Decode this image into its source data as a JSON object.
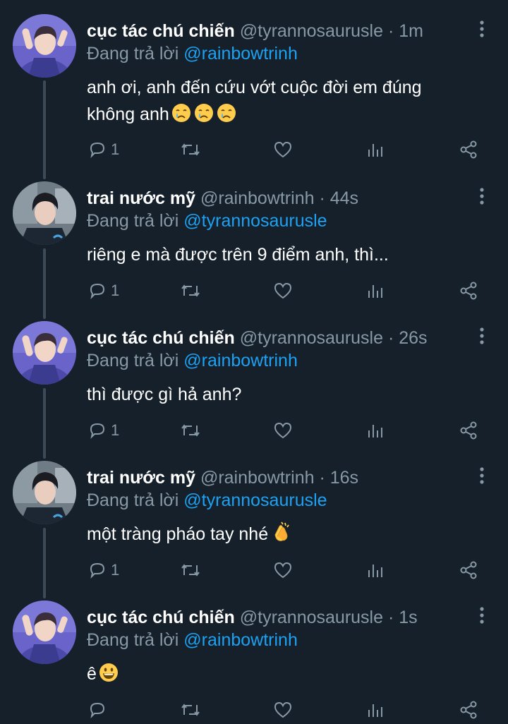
{
  "tweets": [
    {
      "name": "cục tác chú chiến",
      "handle": "@tyrannosaurusle",
      "time": "1m",
      "reply_prefix": "Đang trả lời",
      "reply_to": "@rainbowtrinh",
      "text": "anh ơi, anh đến cứu vớt cuộc đời em đúng không anh",
      "emoji": [
        "crying-face",
        "crying-face",
        "crying-face"
      ],
      "reply_count": "1"
    },
    {
      "name": "trai nước mỹ",
      "handle": "@rainbowtrinh",
      "time": "44s",
      "reply_prefix": "Đang trả lời",
      "reply_to": "@tyrannosaurusle",
      "text": "riêng e mà được trên 9 điểm anh, thì...",
      "emoji": [],
      "reply_count": "1"
    },
    {
      "name": "cục tác chú chiến",
      "handle": "@tyrannosaurusle",
      "time": "26s",
      "reply_prefix": "Đang trả lời",
      "reply_to": "@rainbowtrinh",
      "text": "thì được gì hả anh?",
      "emoji": [],
      "reply_count": "1"
    },
    {
      "name": "trai nước mỹ",
      "handle": "@rainbowtrinh",
      "time": "16s",
      "reply_prefix": "Đang trả lời",
      "reply_to": "@tyrannosaurusle",
      "text": "một tràng pháo tay nhé",
      "emoji": [
        "clapping-hands"
      ],
      "reply_count": "1"
    },
    {
      "name": "cục tác chú chiến",
      "handle": "@tyrannosaurusle",
      "time": "1s",
      "reply_prefix": "Đang trả lời",
      "reply_to": "@rainbowtrinh",
      "text": "ê",
      "emoji": [
        "grinning-face"
      ],
      "reply_count": ""
    }
  ],
  "separator": " · ",
  "colors": {
    "background": "#15202b",
    "secondary_text": "#8899a6",
    "mention": "#1da1f2",
    "thread_line": "#3d4b59"
  },
  "icons": [
    "reply-icon",
    "retweet-icon",
    "like-icon",
    "analytics-icon",
    "share-icon",
    "more-options-icon"
  ]
}
